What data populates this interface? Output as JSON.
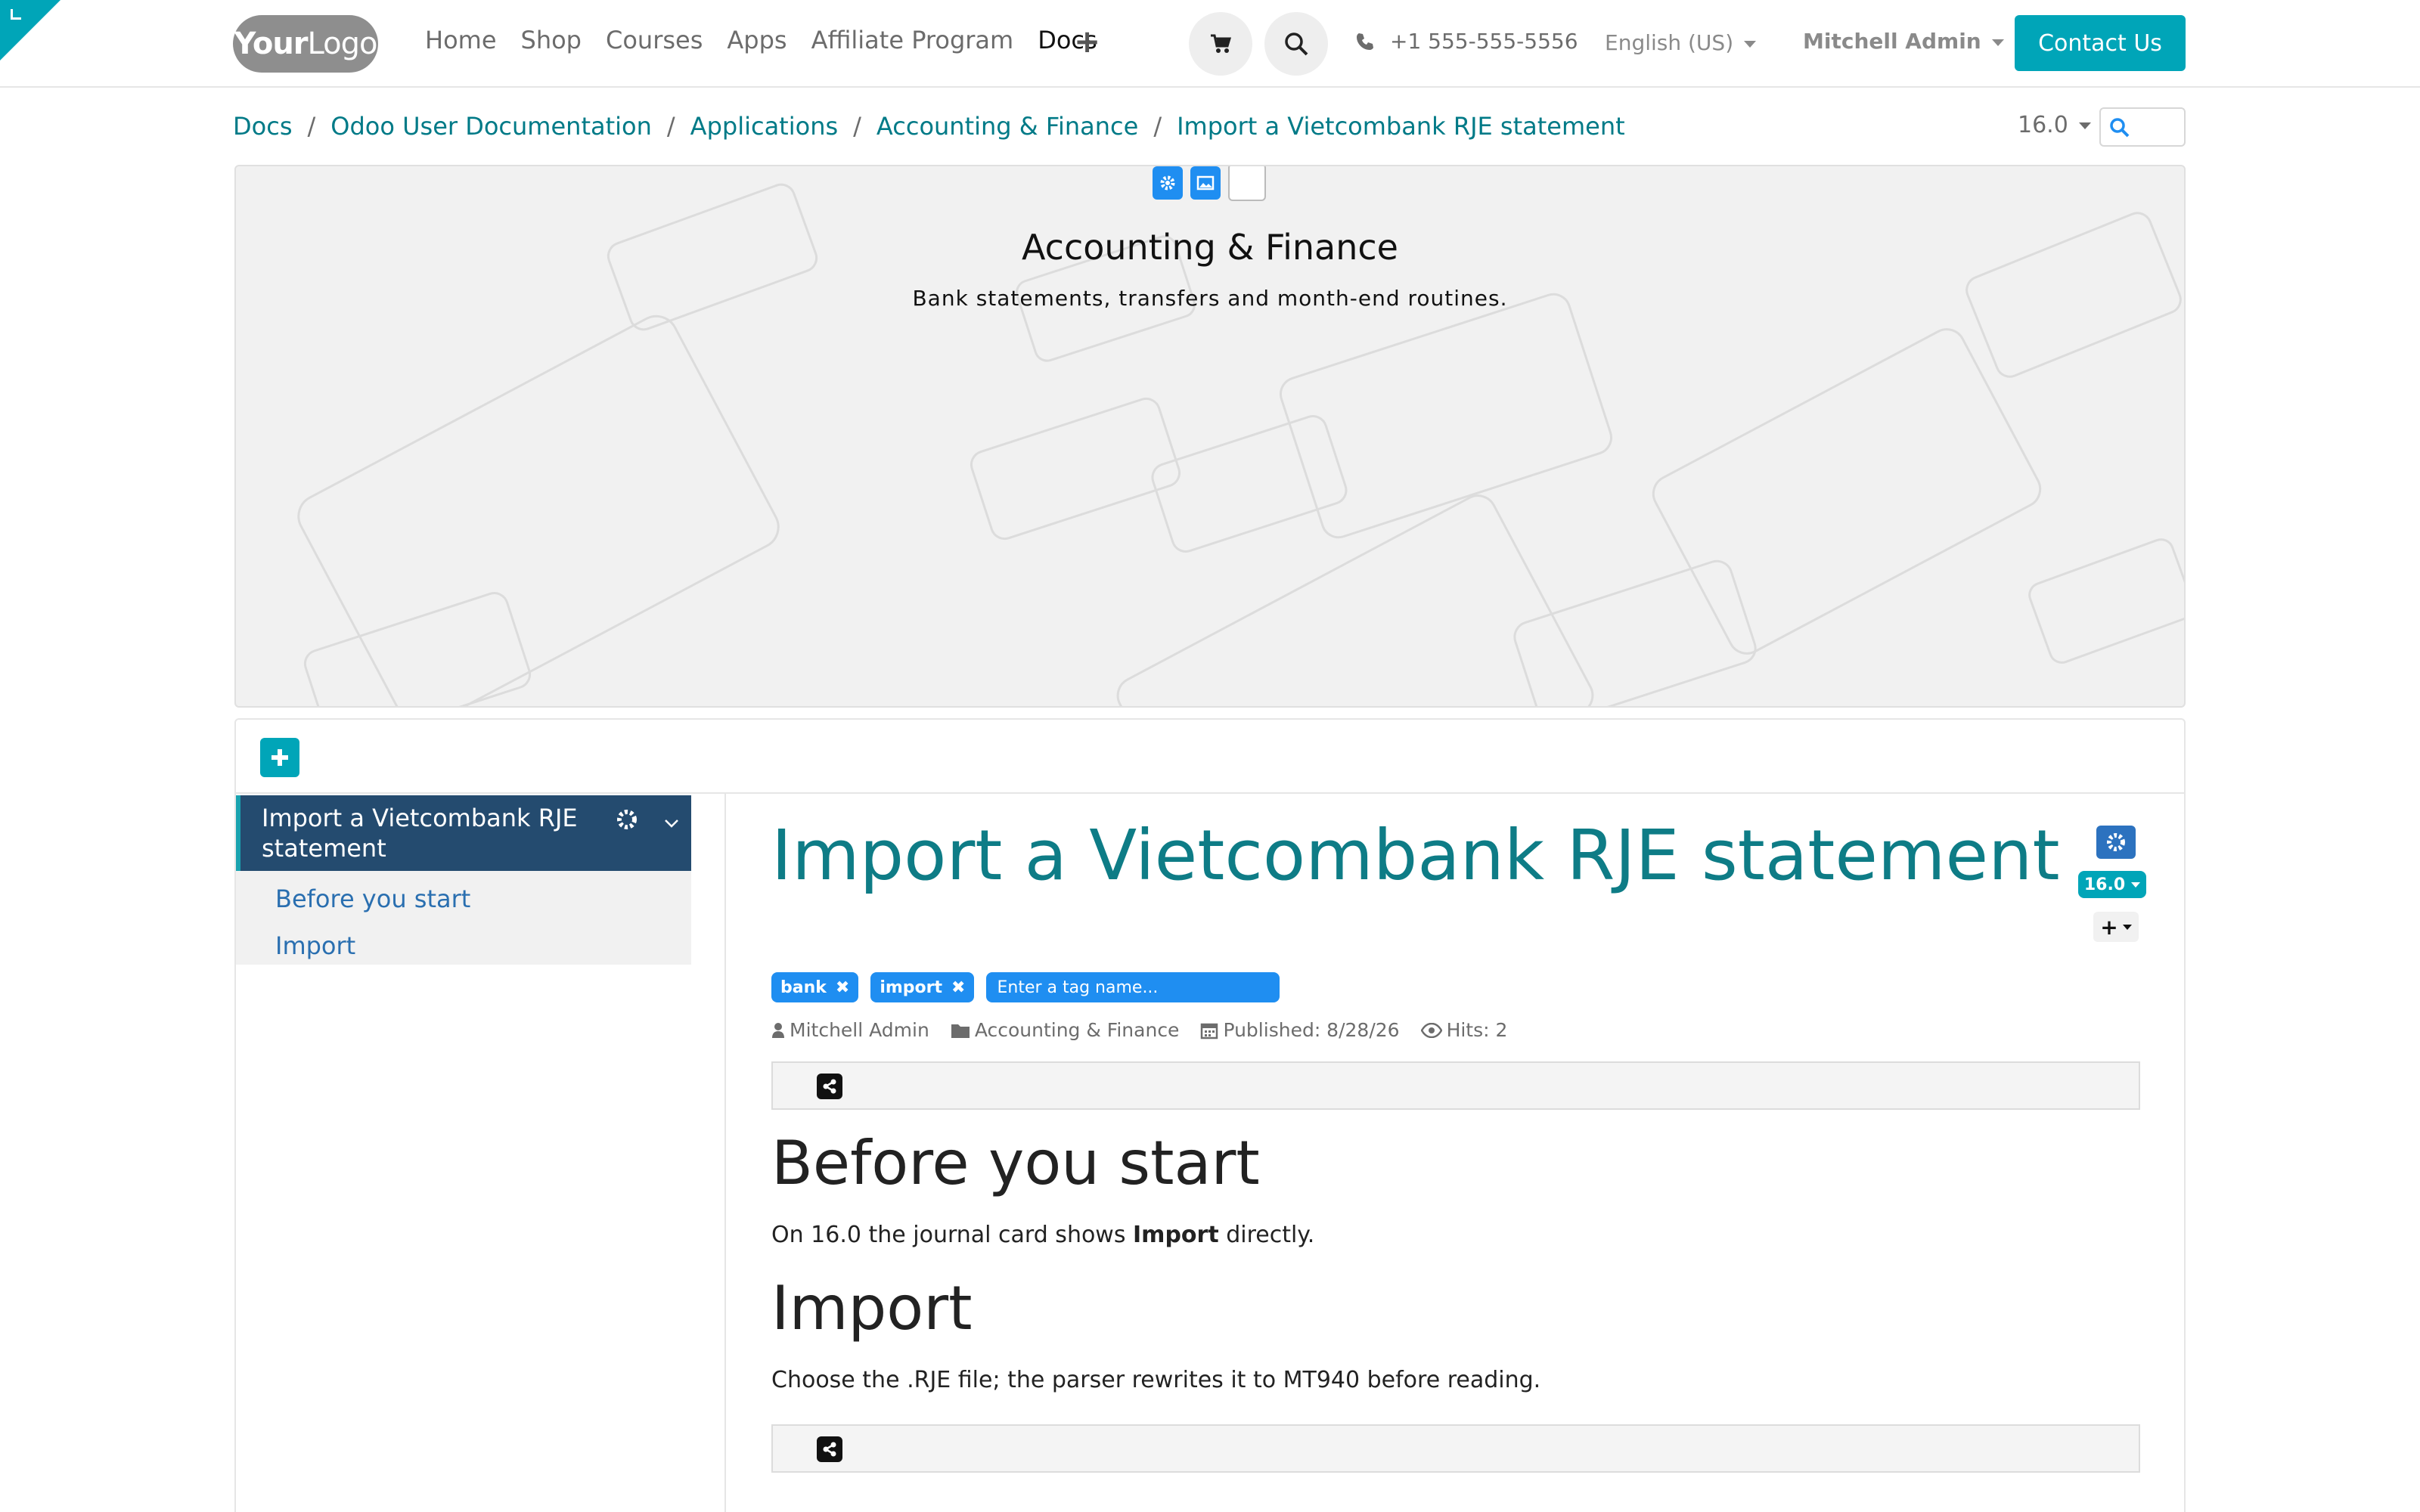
{
  "navbar": {
    "logo_bold": "Your",
    "logo_rest": "Logo",
    "links": [
      "Home",
      "Shop",
      "Courses",
      "Apps",
      "Affiliate Program",
      "Docs"
    ],
    "phone": "+1 555-555-5556",
    "language": "English (US)",
    "user": "Mitchell Admin",
    "contact_label": "Contact Us"
  },
  "breadcrumb": [
    "Docs",
    "Odoo User Documentation",
    "Applications",
    "Accounting & Finance",
    "Import a Vietcombank RJE statement"
  ],
  "version": "16.0",
  "hero": {
    "title": "Accounting & Finance",
    "subtitle": "Bank statements, transfers and month-end routines."
  },
  "sidebar": {
    "active_label": "Import a Vietcombank RJE statement",
    "items": [
      "Before you start",
      "Import"
    ]
  },
  "article": {
    "title": "Import a Vietcombank RJE statement",
    "version_badge": "16.0",
    "tags": [
      "bank",
      "import"
    ],
    "tag_placeholder": "Enter a tag name...",
    "meta": {
      "author": "Mitchell Admin",
      "category": "Accounting & Finance",
      "published": "Published: 8/28/26",
      "hits": "Hits: 2"
    },
    "sections": [
      {
        "heading": "Before you start",
        "text_before": "On 16.0 the journal card shows ",
        "text_bold": "Import",
        "text_after": " directly."
      },
      {
        "heading": "Import",
        "text": "Choose the .RJE file; the parser rewrites it to MT940 before reading."
      }
    ]
  },
  "colors": {
    "accent": "#00a5b8",
    "link": "#007a87",
    "title": "#0e7c86",
    "tag_blue": "#1f8ef1",
    "sidebar_active": "#244b6f"
  },
  "icons": [
    "cart-icon",
    "search-icon",
    "phone-icon",
    "plus-icon",
    "gear-icon",
    "image-icon",
    "chevron-down-icon",
    "user-icon",
    "folder-icon",
    "calendar-icon",
    "eye-icon",
    "share-icon",
    "close-icon"
  ]
}
